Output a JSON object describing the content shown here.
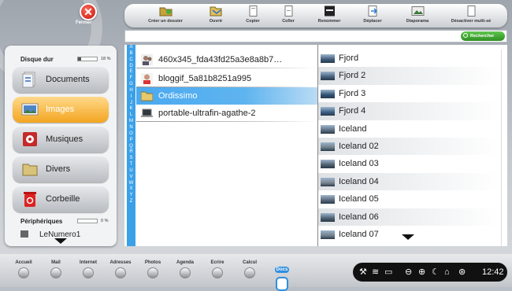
{
  "header": {
    "close_label": "Fermer",
    "toolbar": [
      {
        "label": "Créer un dossier",
        "icon": "new-folder-icon"
      },
      {
        "label": "Ouvrir",
        "icon": "open-icon"
      },
      {
        "label": "Copier",
        "icon": "copy-icon"
      },
      {
        "label": "Coller",
        "icon": "paste-icon"
      },
      {
        "label": "Renommer",
        "icon": "rename-icon"
      },
      {
        "label": "Déplacer",
        "icon": "move-icon"
      },
      {
        "label": "Diaporama",
        "icon": "slideshow-icon"
      },
      {
        "label": "Désactiver multi-sé",
        "icon": "multi-select-icon"
      }
    ],
    "search": {
      "value": "",
      "button_label": "Rechercher"
    }
  },
  "sidebar": {
    "disk_label": "Disque dur",
    "disk_pct": "18 %",
    "disk_fill": 0.18,
    "categories": [
      {
        "label": "Documents",
        "icon": "documents-icon"
      },
      {
        "label": "Images",
        "icon": "images-icon",
        "active": true
      },
      {
        "label": "Musiques",
        "icon": "music-icon"
      },
      {
        "label": "Divers",
        "icon": "folder-icon"
      },
      {
        "label": "Corbeille",
        "icon": "trash-icon"
      }
    ],
    "peripherals_label": "Périphériques",
    "peripherals_pct": "0 %",
    "peripherals_fill": 0,
    "device_label": "LeNumero1"
  },
  "alphabet": [
    "A",
    "B",
    "C",
    "D",
    "E",
    "F",
    "G",
    "H",
    "I",
    "J",
    "K",
    "L",
    "M",
    "N",
    "O",
    "P",
    "Q",
    "R",
    "S",
    "T",
    "U",
    "V",
    "W",
    "X",
    "Y",
    "Z"
  ],
  "folders": [
    {
      "label": "460x345_fda43fd25a3e8a8b7…",
      "icon": "avatar-icon"
    },
    {
      "label": "bloggif_5a81b8251a995",
      "icon": "avatar-icon"
    },
    {
      "label": "Ordissimo",
      "icon": "folder-icon",
      "selected": true
    },
    {
      "label": "portable-ultrafin-agathe-2",
      "icon": "laptop-icon"
    }
  ],
  "images": [
    {
      "label": "Fjord"
    },
    {
      "label": "Fjord 2"
    },
    {
      "label": "Fjord 3"
    },
    {
      "label": "Fjord 4"
    },
    {
      "label": "Iceland"
    },
    {
      "label": "Iceland 02"
    },
    {
      "label": "Iceland 03"
    },
    {
      "label": "Iceland 04"
    },
    {
      "label": "Iceland 05"
    },
    {
      "label": "Iceland 06"
    },
    {
      "label": "Iceland 07"
    }
  ],
  "taskbar": [
    {
      "label": "Accueil",
      "icon": "home-icon"
    },
    {
      "label": "Mail",
      "icon": "mail-icon"
    },
    {
      "label": "Internet",
      "icon": "internet-icon"
    },
    {
      "label": "Adresses",
      "icon": "contacts-icon"
    },
    {
      "label": "Photos",
      "icon": "photos-icon"
    },
    {
      "label": "Agenda",
      "icon": "calendar-icon"
    },
    {
      "label": "Ecrire",
      "icon": "write-icon"
    },
    {
      "label": "Calcul",
      "icon": "calculator-icon"
    },
    {
      "label": "Docs",
      "icon": "docs-icon",
      "active": true
    }
  ],
  "tray": {
    "time": "12:42",
    "icons": [
      "tools-icon",
      "wifi-icon",
      "battery-icon",
      "minus-icon",
      "add-icon",
      "moon-icon",
      "trash-icon",
      "help-icon"
    ]
  },
  "colors": {
    "accent": "#3aa0e8",
    "active_category": "#f3a520",
    "search_button": "#2f8f22"
  }
}
